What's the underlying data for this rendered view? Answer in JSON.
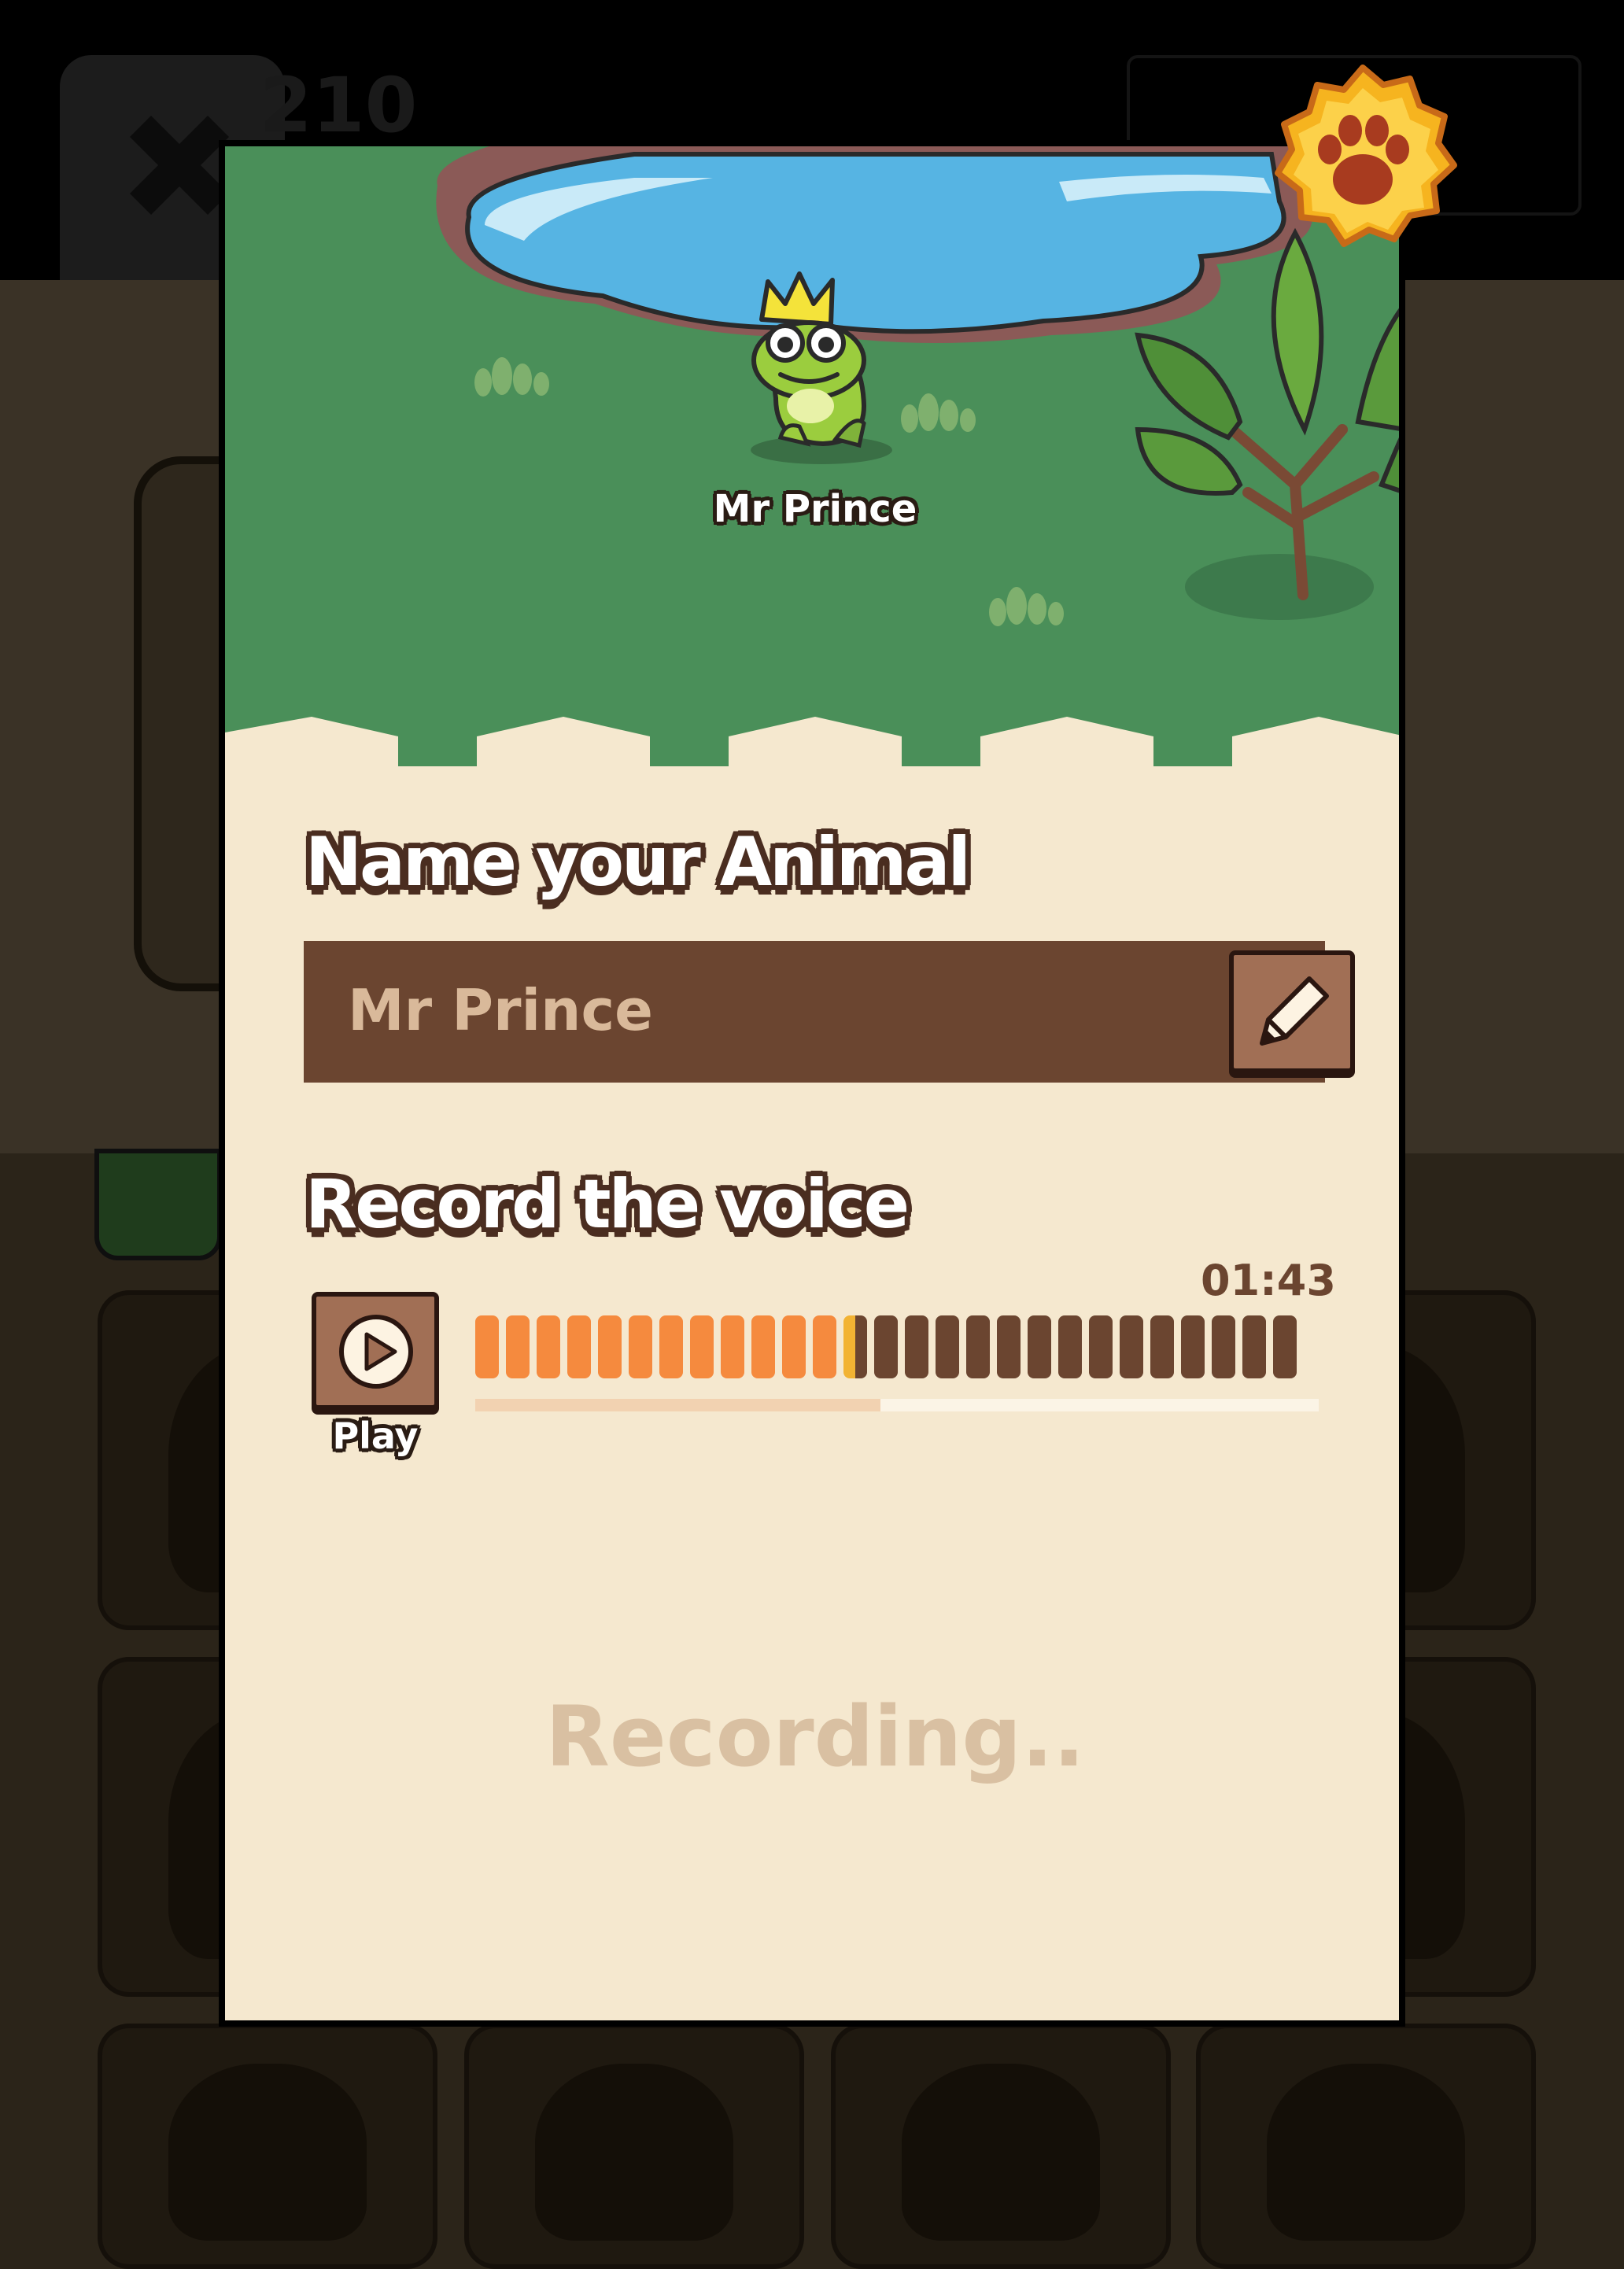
{
  "background": {
    "score_fragment": "210"
  },
  "modal": {
    "animal_label": "Mr Prince",
    "name_section": {
      "heading": "Name your Animal",
      "value": "Mr Prince",
      "edit_icon": "pencil-icon"
    },
    "voice_section": {
      "heading": "Record the voice",
      "timer": "01:43",
      "play_label": "Play",
      "play_icon": "play-icon",
      "bar_count": 27,
      "played_fraction": 0.48
    },
    "status": "Recording..",
    "badge_icon": "paw-icon"
  },
  "colors": {
    "grass": "#4a8f59",
    "cream": "#f5e8cf",
    "brown": "#6b4530",
    "orange": "#f58a3e",
    "pond": "#56b4e3"
  }
}
